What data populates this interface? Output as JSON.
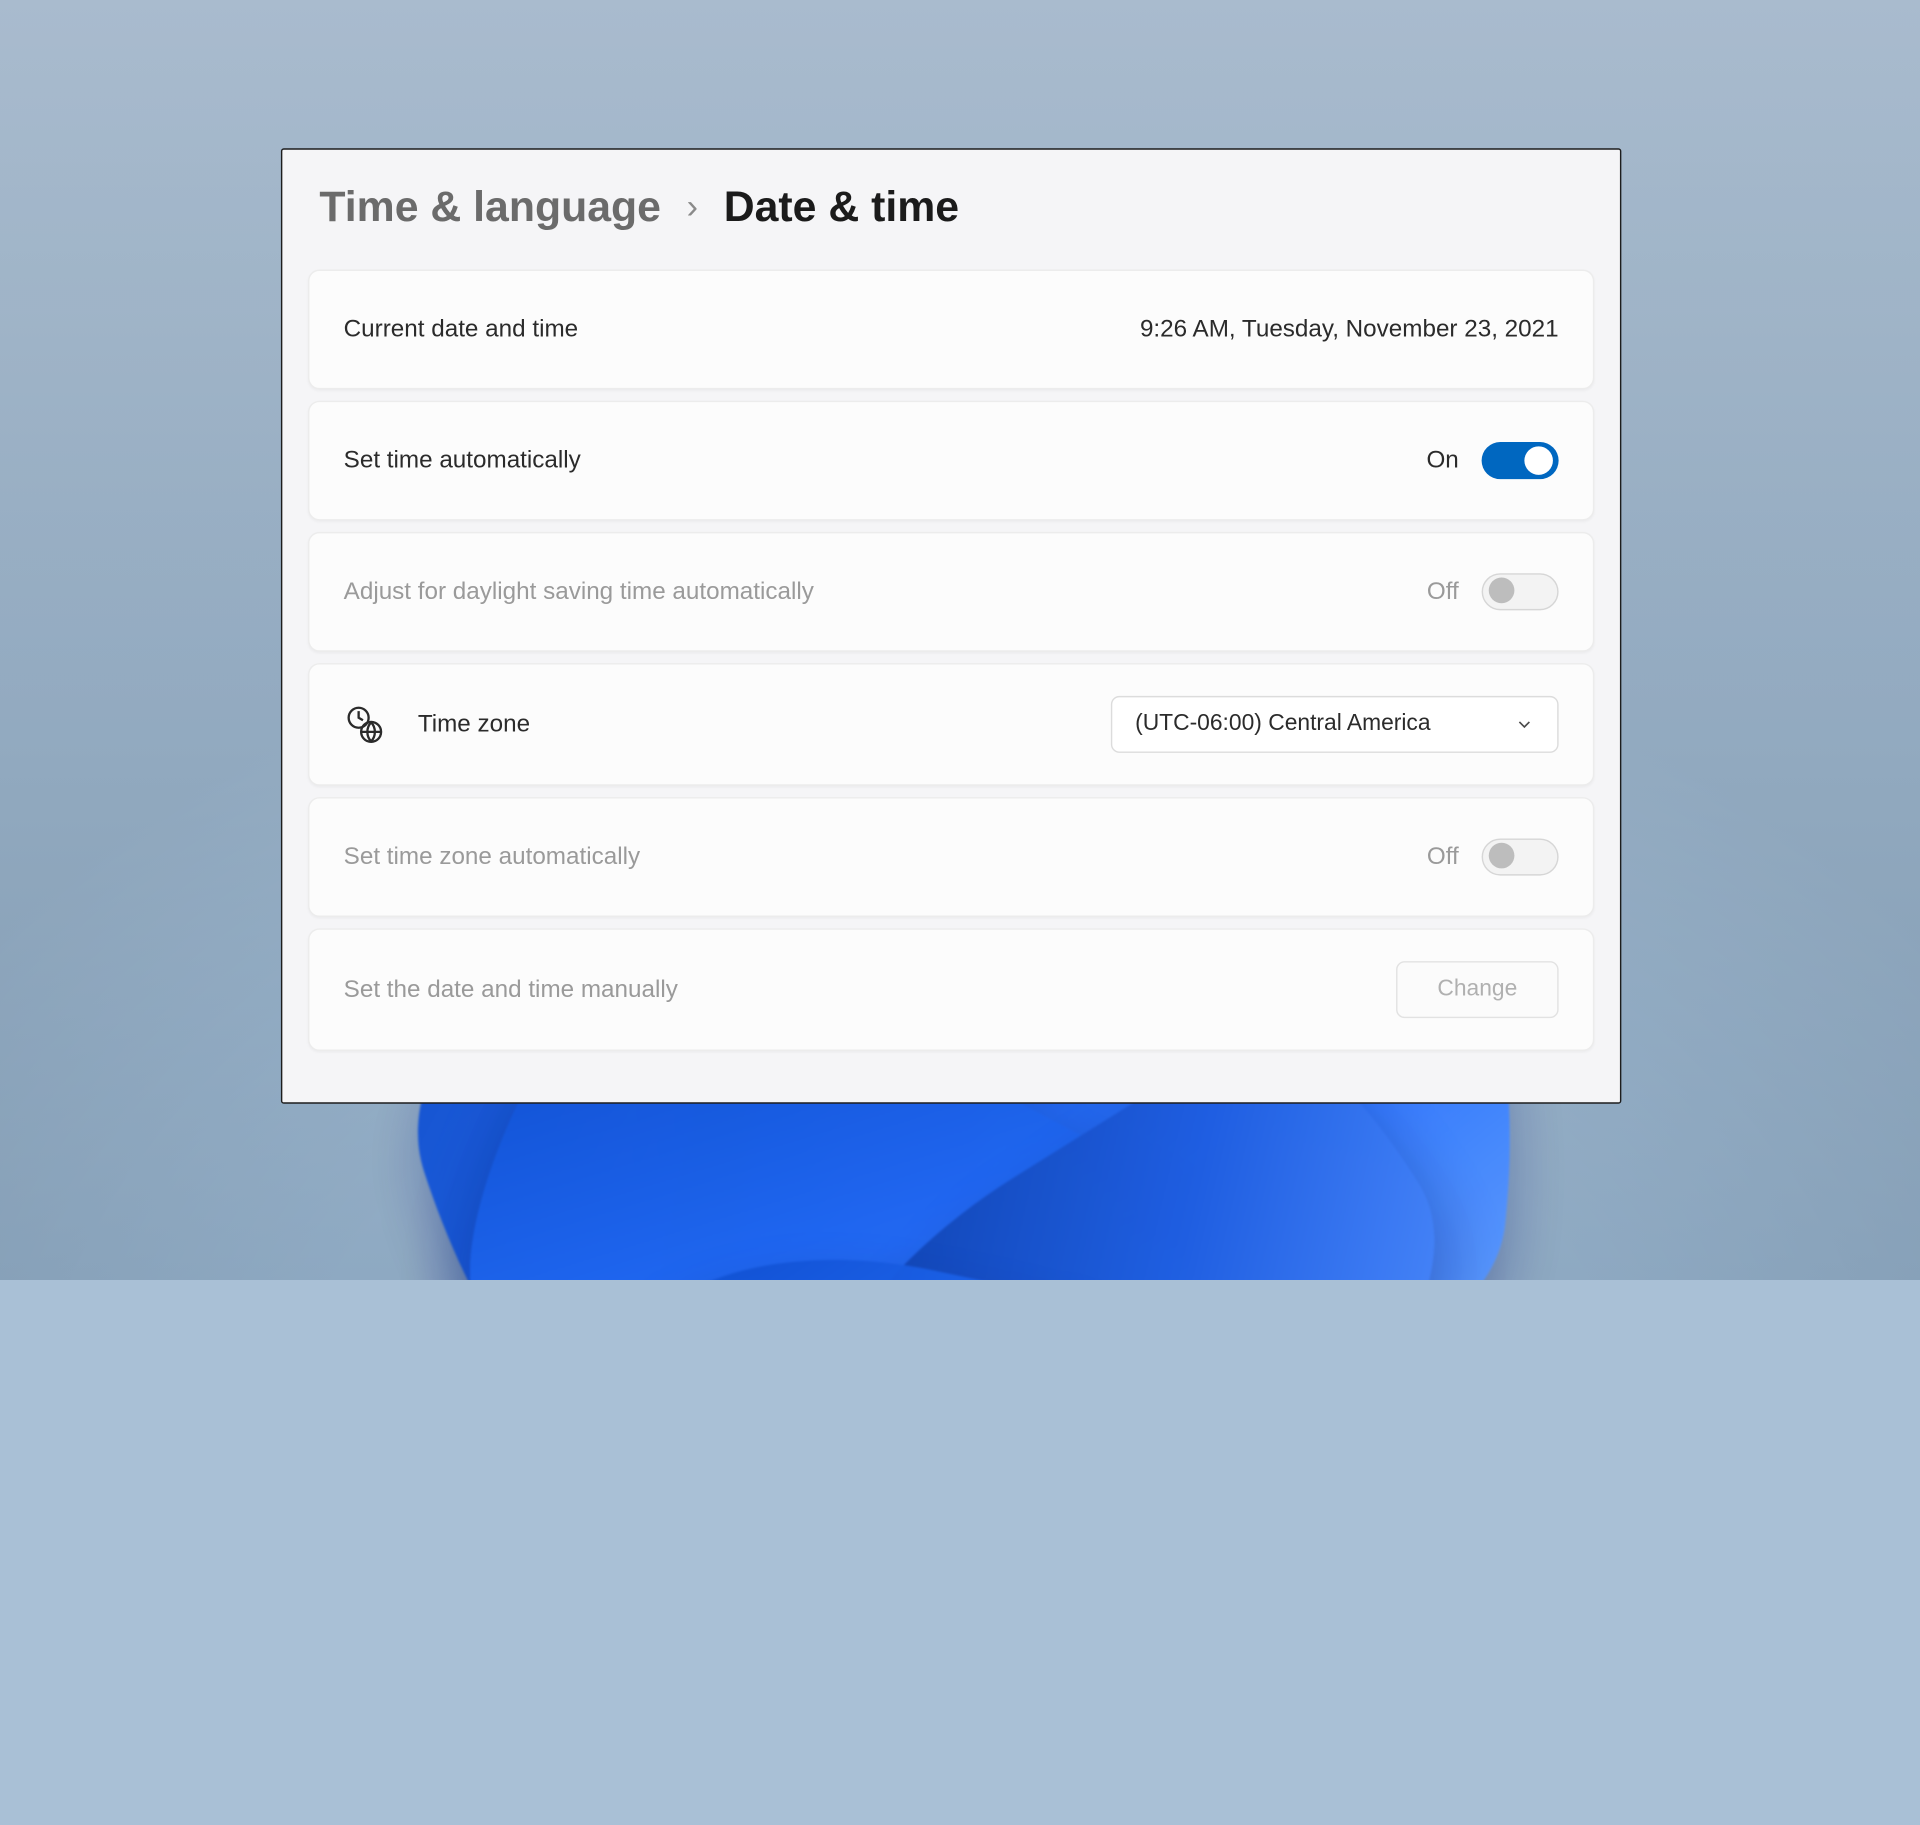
{
  "breadcrumb": {
    "parent": "Time & language",
    "separator": "›",
    "current": "Date & time"
  },
  "rows": {
    "currentDateTime": {
      "label": "Current date and time",
      "value": "9:26 AM, Tuesday, November 23, 2021"
    },
    "setTimeAuto": {
      "label": "Set time automatically",
      "stateText": "On",
      "on": true
    },
    "daylightSaving": {
      "label": "Adjust for daylight saving time automatically",
      "stateText": "Off",
      "on": false,
      "disabled": true
    },
    "timeZone": {
      "label": "Time zone",
      "selected": "(UTC-06:00) Central America",
      "icon": "clock-globe-icon"
    },
    "setTimeZoneAuto": {
      "label": "Set time zone automatically",
      "stateText": "Off",
      "on": false,
      "disabled": true
    },
    "manualDateTime": {
      "label": "Set the date and time manually",
      "button": "Change",
      "disabled": true
    }
  },
  "colors": {
    "accent": "#0067c0"
  }
}
